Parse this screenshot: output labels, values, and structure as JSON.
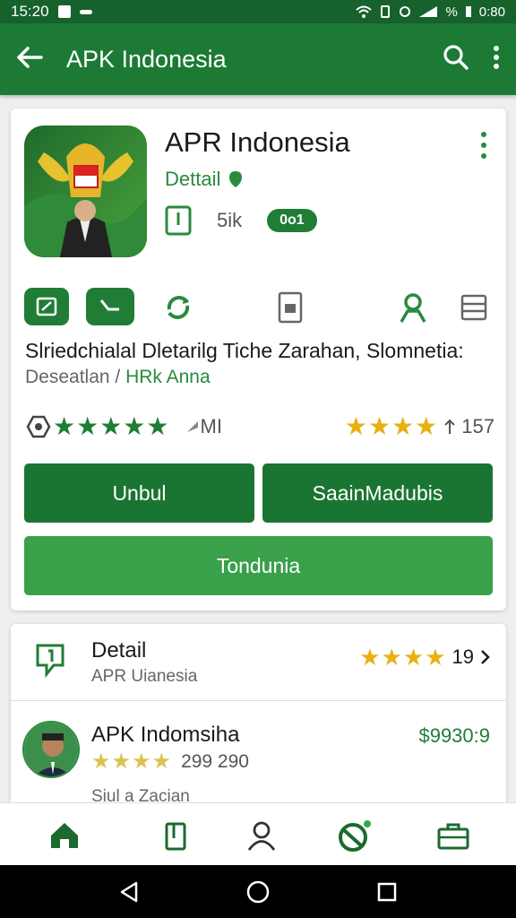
{
  "status_bar": {
    "time": "15:20",
    "battery": "%",
    "clock_right": "0:80"
  },
  "app_bar": {
    "title": "APK Indonesia",
    "back_icon": "arrow-left-icon",
    "search_icon": "search-icon",
    "more_icon": "more-vert-icon"
  },
  "app_card": {
    "name": "APR Indonesia",
    "detail_label": "Dettail",
    "size": "5ik",
    "badge": "0o1",
    "description": "Slriedchialal  Dletarilg  Tiche Zarahan, Slomnetia:",
    "subtitle_prefix": "Deseatlan / ",
    "subtitle_highlight": "HRk Anna",
    "rating_stars": "★★★★★",
    "rating_label": "MI",
    "rating_right_stars": "★★★★",
    "rating_count": "157",
    "buttons": {
      "primary_left": "Unbul",
      "primary_right": "SaainMadubis",
      "secondary": "Tondunia"
    }
  },
  "detail_section": {
    "title": "Detail",
    "subtitle": "APR Uianesia",
    "stars": "★★★★",
    "count": "19",
    "item": {
      "title": "APK Indomsiha",
      "price": "$9930:9",
      "stars": "★★★★",
      "count": "299 290",
      "subtitle": "Siul a Zacian"
    }
  },
  "colors": {
    "primary": "#1c7a35",
    "primary_dark": "#17622c",
    "accent": "#3aa04a",
    "star_gold": "#e8b10f"
  }
}
